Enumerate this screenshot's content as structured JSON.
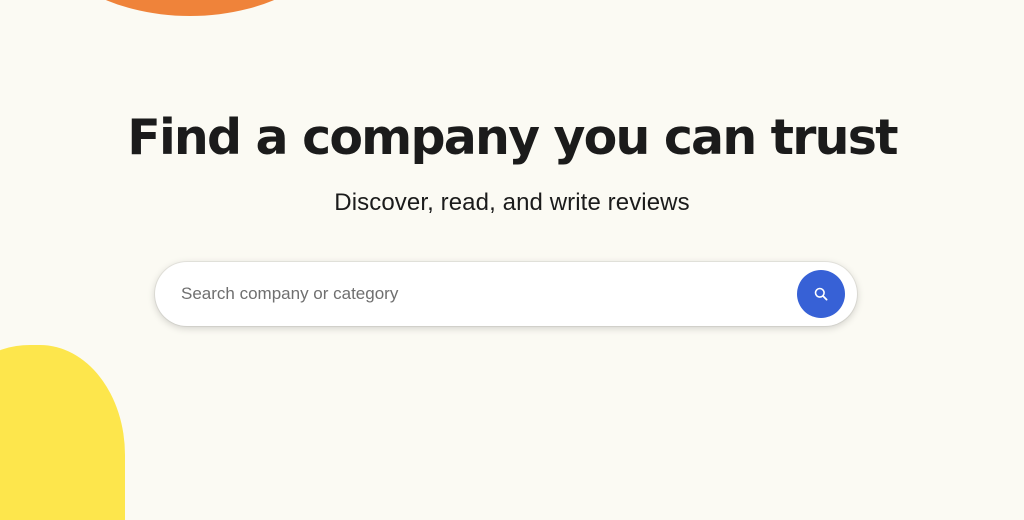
{
  "hero": {
    "headline": "Find a company you can trust",
    "subheadline": "Discover, read, and write reviews"
  },
  "search": {
    "placeholder": "Search company or category",
    "value": "",
    "button_icon": "search-icon"
  },
  "colors": {
    "background": "#fbfaf3",
    "accent_blue": "#3761d6",
    "decor_orange": "#ef833a",
    "decor_yellow": "#fde64c",
    "text": "#1b1b1b"
  }
}
